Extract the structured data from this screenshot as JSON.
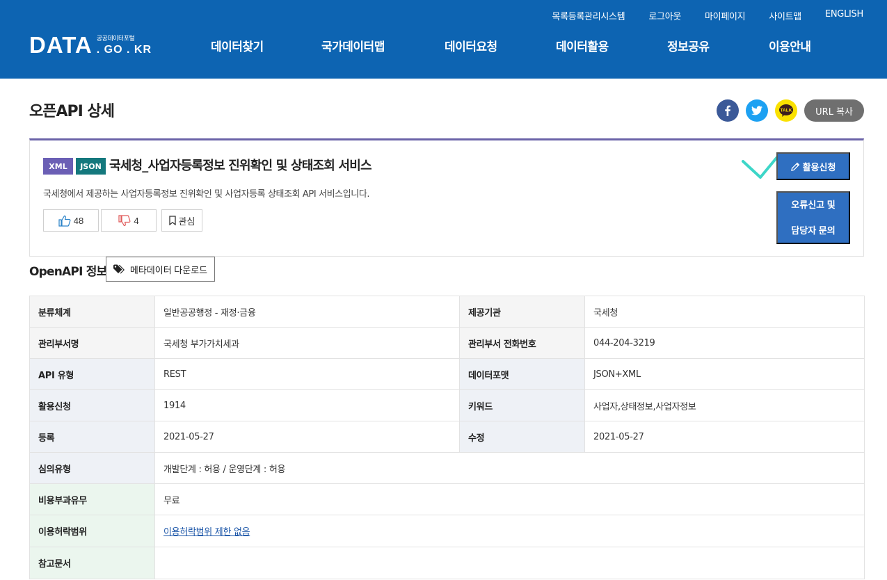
{
  "header": {
    "util_links": [
      "목록등록관리시스템",
      "로그아웃",
      "마이페이지",
      "사이트맵",
      "ENGLISH"
    ],
    "logo": {
      "main": "DATA",
      "sub_top": "공공데이터포털",
      "sub_bottom": ". GO . KR"
    },
    "nav": [
      "데이터찾기",
      "국가데이터맵",
      "데이터요청",
      "데이터활용",
      "정보공유",
      "이용안내"
    ]
  },
  "page": {
    "title": "오픈API 상세",
    "share": {
      "url_copy_label": "URL 복사",
      "kakao_label": "TALK"
    }
  },
  "detail": {
    "tags": [
      "XML",
      "JSON"
    ],
    "title": "국세청_사업자등록정보 진위확인 및 상태조회 서비스",
    "description": "국세청에서 제공하는 사업자등록정보 진위확인 및 사업자등록 상태조회 API 서비스입니다.",
    "likes": "48",
    "dislikes": "4",
    "favorite_label": "관심",
    "apply_label": "활용신청",
    "report_label_1": "오류신고 및",
    "report_label_2": "담당자 문의"
  },
  "openapi": {
    "title": "OpenAPI 정보",
    "meta_download_label": "메타데이터 다운로드",
    "rows": [
      {
        "k1": "분류체계",
        "v1": "일반공공행정 - 재정·금융",
        "k2": "제공기관",
        "v2": "국세청"
      },
      {
        "k1": "관리부서명",
        "v1": "국세청 부가가치세과",
        "k2": "관리부서 전화번호",
        "v2": "044-204-3219"
      },
      {
        "k1": "API 유형",
        "v1": "REST",
        "k2": "데이터포맷",
        "v2": "JSON+XML"
      },
      {
        "k1": "활용신청",
        "v1": "1914",
        "k2": "키워드",
        "v2": "사업자,상태정보,사업자정보"
      },
      {
        "k1": "등록",
        "v1": "2021-05-27",
        "k2": "수정",
        "v2": "2021-05-27"
      }
    ],
    "wide_rows": [
      {
        "k": "심의유형",
        "v": "개발단계 : 허용 / 운영단계 : 허용"
      },
      {
        "k": "비용부과유무",
        "v": "무료"
      },
      {
        "k": "이용허락범위",
        "v": "이용허락범위 제한 없음"
      },
      {
        "k": "참고문서",
        "v": ""
      }
    ]
  },
  "colors": {
    "header_bg": "#0d64b2",
    "button_blue": "#2f6fc1",
    "tag_xml": "#6b5fb5",
    "tag_json": "#14787d",
    "box_top_border": "#6b63a8",
    "check_annotation": "#3dd6c8"
  },
  "icons": [
    "facebook-icon",
    "twitter-icon",
    "kakaotalk-icon",
    "thumbs-up-icon",
    "thumbs-down-icon",
    "bookmark-icon",
    "pencil-icon",
    "tags-icon",
    "checkmark-annotation-icon"
  ]
}
